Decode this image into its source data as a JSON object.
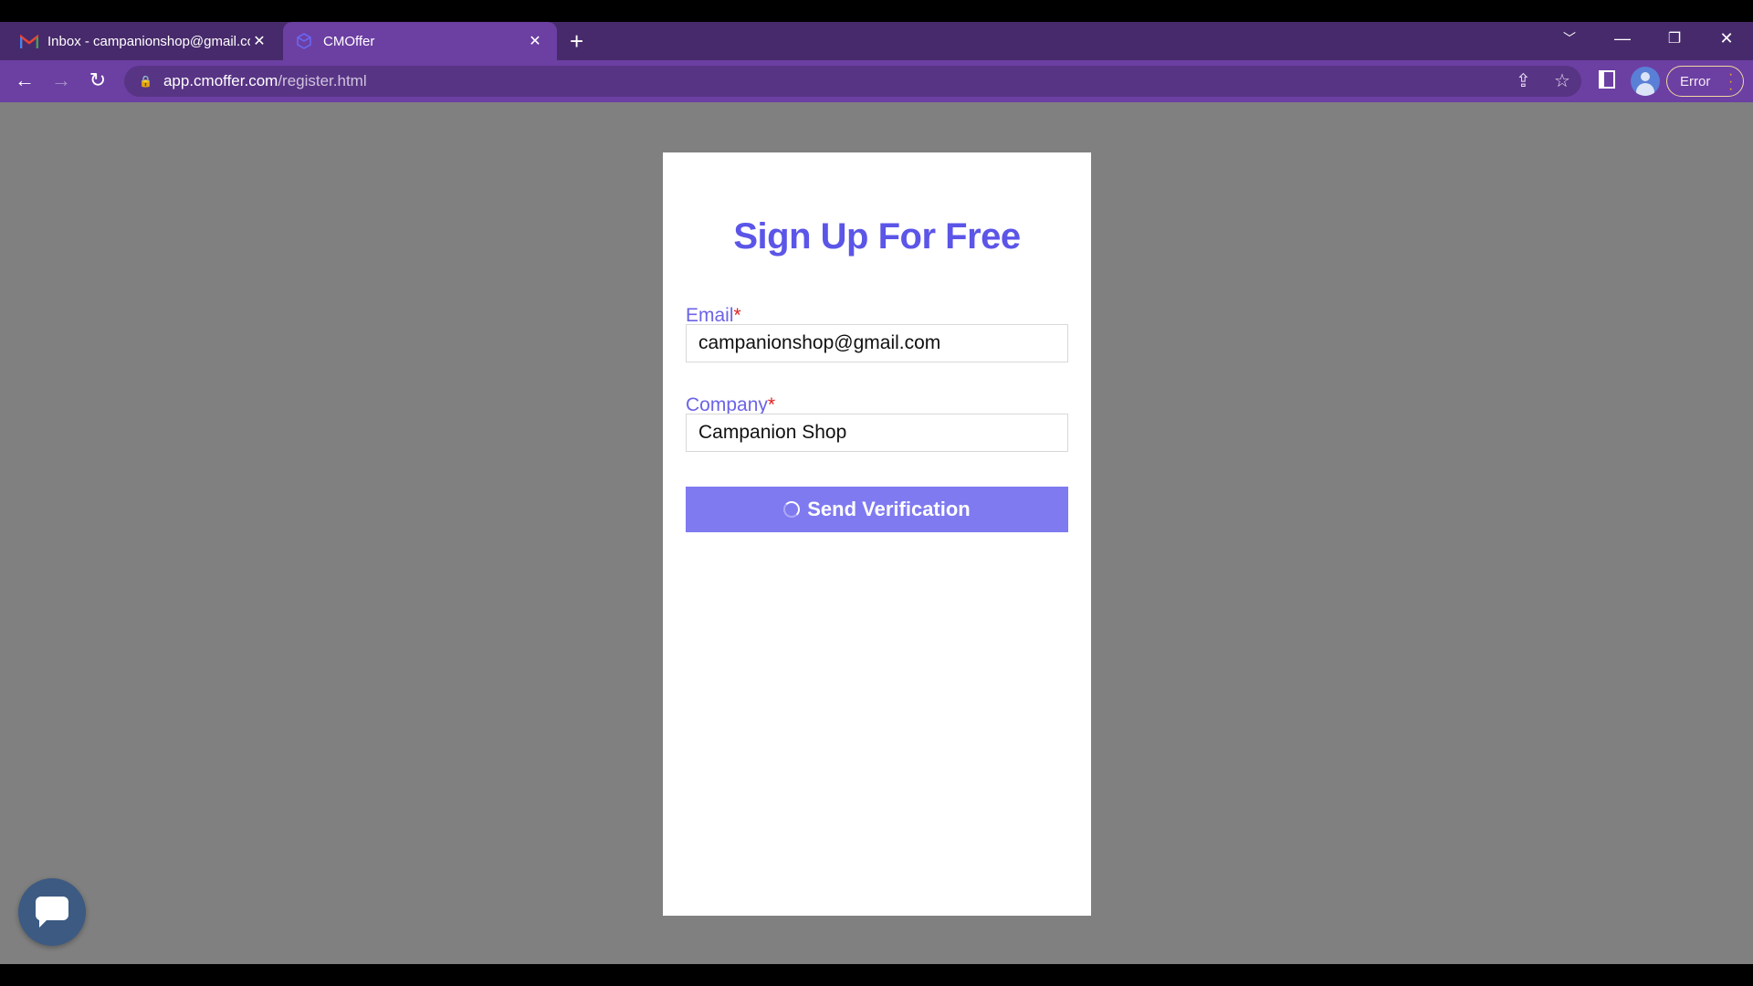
{
  "browser": {
    "tabs": [
      {
        "title": "Inbox - campanionshop@gmail.com",
        "icon": "gmail-icon",
        "active": false
      },
      {
        "title": "CMOffer",
        "icon": "cmoffer-icon",
        "active": true
      }
    ],
    "url_host": "app.cmoffer.com",
    "url_path": "/register.html",
    "profile_status": "Error"
  },
  "form": {
    "title": "Sign Up For Free",
    "email_label": "Email",
    "email_value": "campanionshop@gmail.com",
    "company_label": "Company",
    "company_value": "Campanion Shop",
    "required_mark": "*",
    "submit_label": "Send Verification",
    "submit_loading": true
  },
  "colors": {
    "accent": "#5b55e8",
    "button": "#7f7af0",
    "required": "#e02020",
    "browser_frame": "#6c3fa3"
  }
}
